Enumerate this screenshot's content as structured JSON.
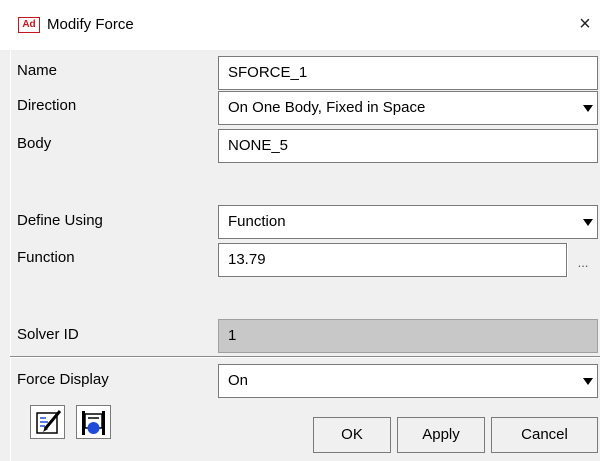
{
  "window": {
    "app_icon_text": "Ad",
    "title": "Modify Force",
    "close_glyph": "×"
  },
  "fields": {
    "name": {
      "label": "Name",
      "value": "SFORCE_1"
    },
    "direction": {
      "label": "Direction",
      "value": "On One Body, Fixed in Space"
    },
    "body": {
      "label": "Body",
      "value": "NONE_5"
    },
    "define_using": {
      "label": "Define Using",
      "value": "Function"
    },
    "function": {
      "label": "Function",
      "value": "13.79",
      "browse_label": "..."
    },
    "solver_id": {
      "label": "Solver ID",
      "value": "1"
    },
    "force_display": {
      "label": "Force Display",
      "value": "On"
    }
  },
  "buttons": {
    "ok": "OK",
    "apply": "Apply",
    "cancel": "Cancel"
  },
  "icons": {
    "edit": "function-builder-icon",
    "measure": "measure-plot-icon"
  },
  "colors": {
    "app_icon": "#c4161c",
    "disabled_field": "#c8c8c8",
    "icon_blue": "#1f4bd8"
  }
}
